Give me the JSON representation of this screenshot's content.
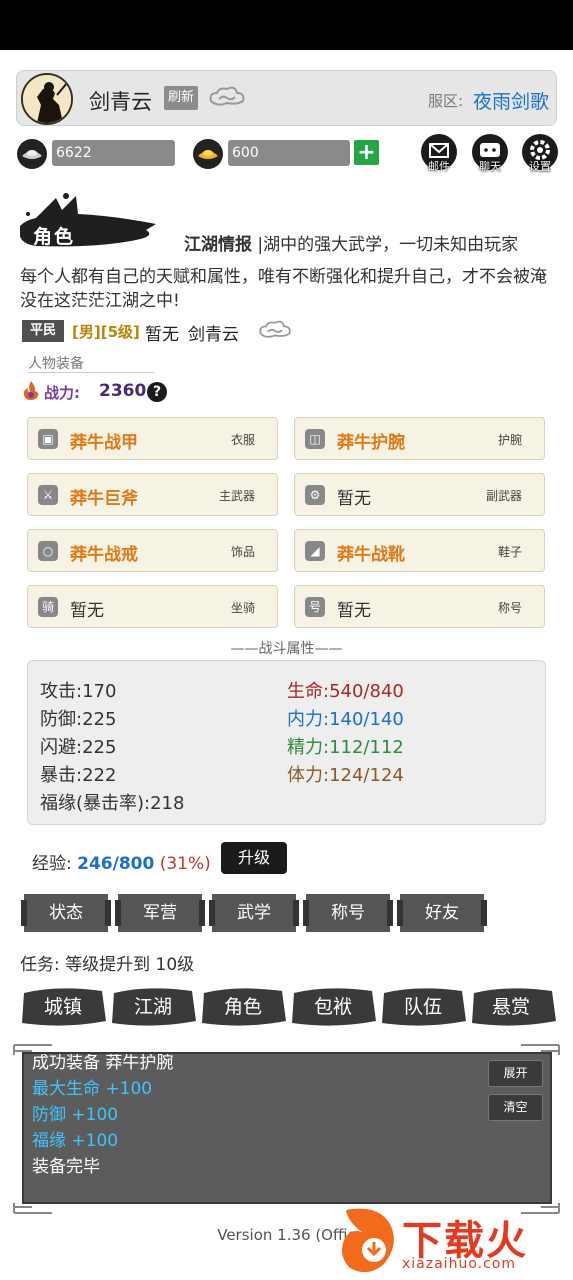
{
  "header": {
    "player_name": "剑青云",
    "refresh_label": "刷新",
    "server_label": "服区:",
    "server_name": "夜雨剑歌"
  },
  "resources": {
    "silver": "6622",
    "gold": "600",
    "add_label": "+"
  },
  "top_buttons": {
    "mail": "邮件",
    "chat": "聊天",
    "settings": "设置"
  },
  "section_title": "角色",
  "intro": {
    "title": "江湖情报",
    "line1_rest": "|湖中的强大武学，一切未知由玩家",
    "line2": "每个人都有自己的天赋和属性，唯有不断强化和提升自己，才不会被淹没在这茫茫江湖之中!"
  },
  "character": {
    "rank": "平民",
    "gender_level": "[男][5级]",
    "guild": "暂无",
    "name": "剑青云"
  },
  "equipment": {
    "section_label": "人物装备",
    "power_label": "战力:",
    "power_value": "2360",
    "help": "?",
    "slots": [
      {
        "name": "莽牛战甲",
        "type": "衣服",
        "equipped": true,
        "icon": "armor-icon"
      },
      {
        "name": "莽牛护腕",
        "type": "护腕",
        "equipped": true,
        "icon": "bracer-icon"
      },
      {
        "name": "莽牛巨斧",
        "type": "主武器",
        "equipped": true,
        "icon": "weapon-icon"
      },
      {
        "name": "暂无",
        "type": "副武器",
        "equipped": false,
        "icon": "offhand-icon"
      },
      {
        "name": "莽牛战戒",
        "type": "饰品",
        "equipped": true,
        "icon": "ring-icon"
      },
      {
        "name": "莽牛战靴",
        "type": "鞋子",
        "equipped": true,
        "icon": "boots-icon"
      },
      {
        "name": "暂无",
        "type": "坐骑",
        "equipped": false,
        "icon": "mount-icon",
        "glyph": "骑"
      },
      {
        "name": "暂无",
        "type": "称号",
        "equipped": false,
        "icon": "title-icon",
        "glyph": "号"
      }
    ]
  },
  "battle": {
    "title": "——战斗属性——",
    "attack_label": "攻击:",
    "attack": "170",
    "defense_label": "防御:",
    "defense": "225",
    "dodge_label": "闪避:",
    "dodge": "225",
    "crit_label": "暴击:",
    "crit": "222",
    "luck_label": "福缘(暴击率):",
    "luck": "218",
    "hp_label": "生命:",
    "hp": "540/840",
    "mp_label": "内力:",
    "mp": "140/140",
    "spirit_label": "精力:",
    "spirit": "112/112",
    "stamina_label": "体力:",
    "stamina": "124/124"
  },
  "experience": {
    "label": "经验:",
    "value": "246/800",
    "percent": "(31%)",
    "levelup_label": "升级"
  },
  "tabs": [
    "状态",
    "军营",
    "武学",
    "称号",
    "好友"
  ],
  "task": "任务: 等级提升到 10级",
  "nav": [
    "城镇",
    "江湖",
    "角色",
    "包袱",
    "队伍",
    "悬赏"
  ],
  "log": {
    "lines": [
      {
        "text": "成功装备 莽牛护腕",
        "color": "#ffffff"
      },
      {
        "text": "最大生命 +100",
        "color": "#3fc3ff"
      },
      {
        "text": "防御 +100",
        "color": "#3fc3ff"
      },
      {
        "text": "福缘 +100",
        "color": "#3fc3ff"
      },
      {
        "text": "装备完毕",
        "color": "#ffffff"
      }
    ],
    "expand_label": "展开",
    "clear_label": "清空"
  },
  "version": "Version 1.36 (Offic",
  "watermark": {
    "title": "下载火",
    "sub": "xiazaihuo.com"
  },
  "colors": {
    "accent_blue": "#1a6fd1",
    "equipped_orange": "#e07a16",
    "power_purple": "#4b2a7c",
    "log_cyan": "#3fc3ff"
  }
}
